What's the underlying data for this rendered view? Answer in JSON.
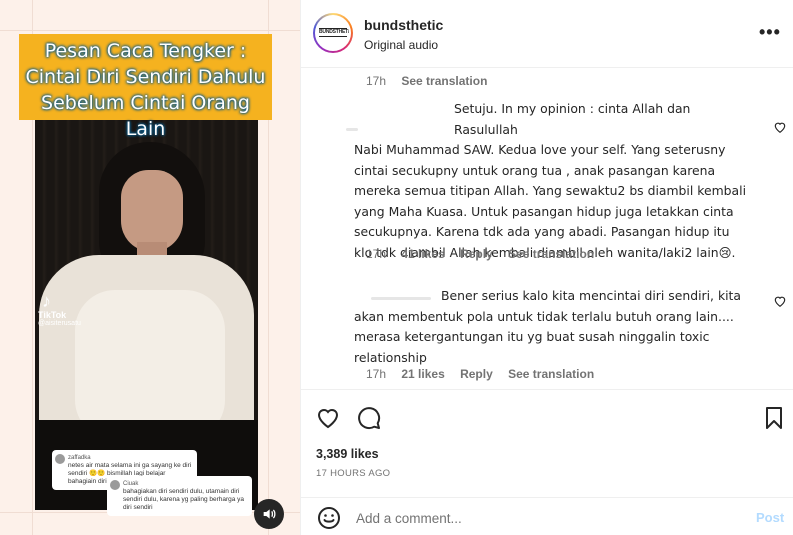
{
  "media": {
    "banner_lines": [
      "Pesan Caca Tengker :",
      "Cintai Diri Sendiri Dahulu",
      "Sebelum Cintai Orang Lain"
    ],
    "tiktok_label": "TikTok",
    "tiktok_user": "@aisiterusatu",
    "overlay_comments": [
      {
        "name": "zaffadka",
        "text": "netes air mata selama ini ga sayang ke diri sendiri 🙂🙂 bismillah lagi belajar bahagiain diri sendiri."
      },
      {
        "name": "Ciuak",
        "text": "bahagiakan diri sendiri dulu, utamain diri sendiri dulu, karena yg paling berharga ya diri sendiri"
      }
    ],
    "sound_icon": "speaker-icon"
  },
  "header": {
    "username": "bundsthetic",
    "audio": "Original audio",
    "avatar_text": "BUNDSTHETIC",
    "more_label": "•••"
  },
  "comments": {
    "top_meta": {
      "time": "17h",
      "see_translation": "See translation"
    },
    "items": [
      {
        "lines": [
          "Setuju. In my opinion : cinta Allah dan Rasulullah",
          "Nabi Muhammad SAW. Kedua love your self. Yang seterusny",
          "cintai secukupny untuk orang tua , anak pasangan karena",
          "mereka semua titipan Allah. Yang sewaktu2 bs diambil kembali",
          "yang Maha Kuasa. Untuk pasangan hidup juga letakkan cinta",
          "secukupnya. Karena tdk ada yang abadi. Pasangan hidup itu",
          "klo tdk diambil Allah kembali diambil oleh wanita/laki2 lain😢."
        ],
        "time": "17h",
        "likes": "41 likes",
        "reply": "Reply",
        "see_translation": "See translation"
      },
      {
        "lines": [
          "Bener serius kalo kita mencintai diri sendiri, kita",
          "akan membentuk pola untuk tidak terlalu butuh orang lain....",
          "merasa ketergantungan itu yg buat susah ninggalin toxic",
          "relationship"
        ],
        "time": "17h",
        "likes": "21 likes",
        "reply": "Reply",
        "see_translation": "See translation"
      }
    ]
  },
  "actions": {
    "icons": [
      "heart-icon",
      "comment-icon",
      "bookmark-icon"
    ],
    "likes": "3,389 likes",
    "ago": "17 HOURS AGO"
  },
  "add_comment": {
    "placeholder": "Add a comment...",
    "post_label": "Post",
    "emoji_icon": "emoji-icon"
  }
}
